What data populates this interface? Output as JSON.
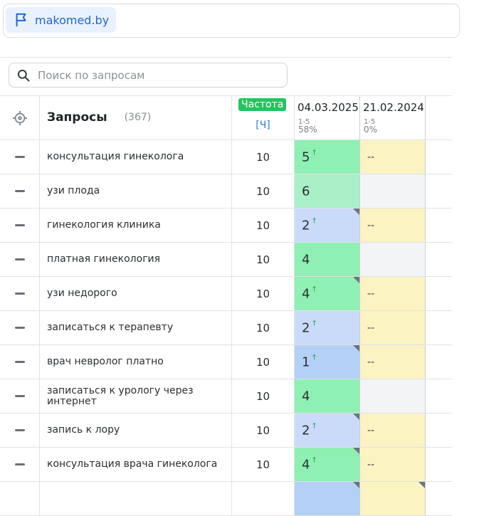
{
  "site": {
    "domain": "makomed.by",
    "icon": "flag-icon"
  },
  "search": {
    "placeholder": "Поиск по запросам",
    "icon": "search-icon"
  },
  "table": {
    "header": {
      "target_icon": "crosshair-icon",
      "title": "Запросы",
      "count": "(367)",
      "freq_badge": "Частота",
      "freq_sub": "[Ч]",
      "dates": [
        {
          "date": "04.03.2025",
          "range": "1-5",
          "percent": "58%"
        },
        {
          "date": "21.02.2024",
          "range": "1-5",
          "percent": "0%"
        }
      ]
    },
    "rows": [
      {
        "query": "консультация гинеколога",
        "freq": "10",
        "pos1": "5",
        "pos2": "--"
      },
      {
        "query": "узи плода",
        "freq": "10",
        "pos1": "6",
        "pos2": ""
      },
      {
        "query": "гинекология клиника",
        "freq": "10",
        "pos1": "2",
        "pos2": "--"
      },
      {
        "query": "платная гинекология",
        "freq": "10",
        "pos1": "4",
        "pos2": ""
      },
      {
        "query": "узи недорого",
        "freq": "10",
        "pos1": "4",
        "pos2": "--"
      },
      {
        "query": "записаться к терапевту",
        "freq": "10",
        "pos1": "2",
        "pos2": "--"
      },
      {
        "query": "врач невролог платно",
        "freq": "10",
        "pos1": "1",
        "pos2": "--"
      },
      {
        "query": "записаться к урологу через интернет",
        "freq": "10",
        "pos1": "4",
        "pos2": ""
      },
      {
        "query": "запись к лору",
        "freq": "10",
        "pos1": "2",
        "pos2": "--"
      },
      {
        "query": "консультация врача гинеколога",
        "freq": "10",
        "pos1": "4",
        "pos2": "--"
      }
    ],
    "arrow": "↑"
  },
  "colors": {
    "top_green": "#8ef0b2",
    "light_green": "#a9efc7",
    "light_blue": "#c9dbf8",
    "blue": "#b5d0f6",
    "no_data_yellow": "#fcf3c2",
    "empty_gray": "#f3f4f6",
    "accent_blue": "#2066d1",
    "badge_green": "#22c55e"
  }
}
